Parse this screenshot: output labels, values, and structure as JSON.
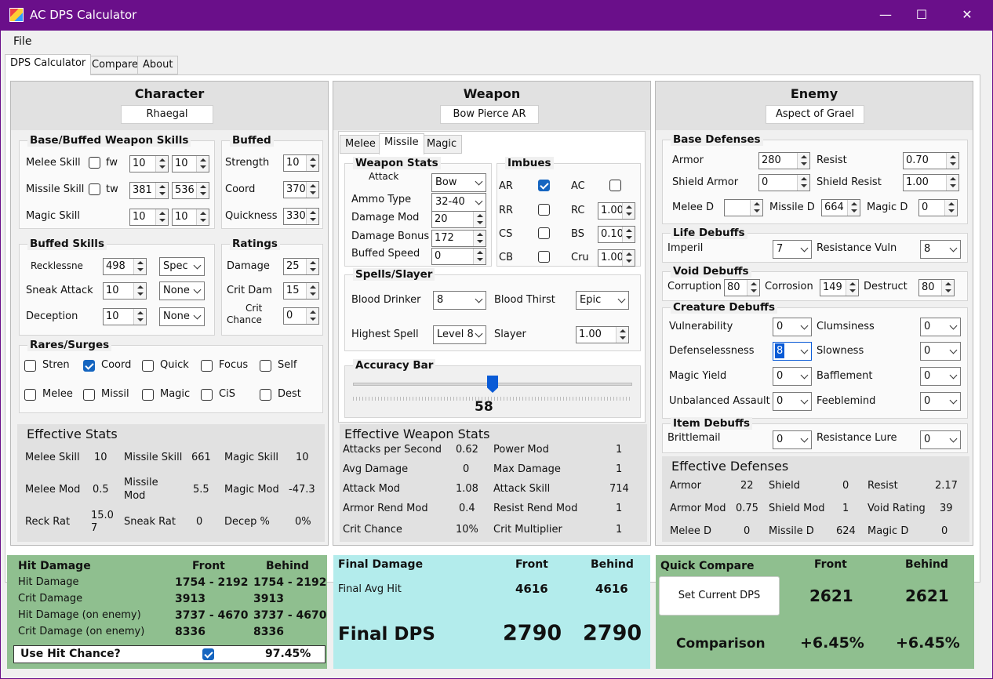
{
  "window": {
    "title": "AC DPS Calculator",
    "min": "—",
    "max": "☐",
    "close": "✕"
  },
  "menu": {
    "file": "File"
  },
  "tabs": [
    "DPS Calculator",
    "Compare",
    "About"
  ],
  "character": {
    "header": "Character",
    "name": "Rhaegal",
    "base_group": "Base/Buffed Weapon Skills",
    "melee_label": "Melee Skill",
    "fw": "fw",
    "melee_base": "10",
    "melee_buffed": "10",
    "missile_label": "Missile Skill",
    "tw": "tw",
    "missile_base": "381",
    "missile_buffed": "536",
    "magic_label": "Magic Skill",
    "magic_base": "10",
    "magic_buffed": "10",
    "buffed_group": "Buffed",
    "strength_label": "Strength",
    "strength": "10",
    "coord_label": "Coord",
    "coord": "370",
    "quick_label": "Quickness",
    "quick": "330",
    "bskills_group": "Buffed Skills",
    "reck_label": "Recklessne",
    "reck": "498",
    "reck_sel": "Spec",
    "sneak_label": "Sneak Attack",
    "sneak": "10",
    "sneak_sel": "None",
    "dec_label": "Deception",
    "dec": "10",
    "dec_sel": "None",
    "ratings_group": "Ratings",
    "dmg_label": "Damage",
    "dmg": "25",
    "critdam_label": "Crit Dam",
    "critdam": "15",
    "critch_label1": "Crit",
    "critch_label2": "Chance",
    "critch": "0",
    "rares_group": "Rares/Surges",
    "rares": [
      {
        "l": "Stren",
        "on": false
      },
      {
        "l": "Coord",
        "on": true
      },
      {
        "l": "Quick",
        "on": false
      },
      {
        "l": "Focus",
        "on": false
      },
      {
        "l": "Self",
        "on": false
      },
      {
        "l": "Melee",
        "on": false
      },
      {
        "l": "Missil",
        "on": false
      },
      {
        "l": "Magic",
        "on": false
      },
      {
        "l": "CiS",
        "on": false
      },
      {
        "l": "Dest",
        "on": false
      }
    ],
    "eff_header": "Effective Stats",
    "eff": {
      "melee_skill_l": "Melee Skill",
      "melee_skill": "10",
      "missile_skill_l": "Missile Skill",
      "missile_skill": "661",
      "magic_skill_l": "Magic Skill",
      "magic_skill": "10",
      "melee_mod_l": "Melee Mod",
      "melee_mod": "0.5",
      "missile_mod_l1": "Missile",
      "missile_mod_l2": "Mod",
      "missile_mod": "5.5",
      "magic_mod_l": "Magic Mod",
      "magic_mod": "-47.3",
      "reck_rat_l": "Reck Rat",
      "reck_rat1": "15.0",
      "reck_rat2": "7",
      "sneak_rat_l": "Sneak Rat",
      "sneak_rat": "0",
      "decep_l": "Decep %",
      "decep": "0%"
    }
  },
  "weapon": {
    "header": "Weapon",
    "name": "Bow Pierce AR",
    "subtabs": [
      "Melee",
      "Missile",
      "Magic"
    ],
    "stats_group": "Weapon Stats",
    "attack_label": "Attack",
    "attack": "Bow",
    "ammo_label": "Ammo Type",
    "ammo": "32-40",
    "dmgmod_label": "Damage Mod",
    "dmgmod": "20",
    "dmgbonus_label": "Damage Bonus",
    "dmgbonus": "172",
    "speed_label": "Buffed Speed",
    "speed": "0",
    "imbues_group": "Imbues",
    "ar": "AR",
    "ac": "AC",
    "rr": "RR",
    "rc": "RC",
    "rc_v": "1.00",
    "cs": "CS",
    "bs": "BS",
    "bs_v": "0.10",
    "cb": "CB",
    "cru": "Cru",
    "cru_v": "1.00",
    "spells_group": "Spells/Slayer",
    "bd_label": "Blood Drinker",
    "bd": "8",
    "bt_label": "Blood Thirst",
    "bt": "Epic",
    "hs_label": "Highest Spell",
    "hs": "Level 8",
    "slayer_label": "Slayer",
    "slayer": "1.00",
    "acc_group": "Accuracy Bar",
    "acc": "58",
    "acc_frac": 0.5,
    "eff_header": "Effective Weapon Stats",
    "eff": {
      "aps_l": "Attacks per Second",
      "aps": "0.62",
      "pm_l": "Power Mod",
      "pm": "1",
      "avg_l": "Avg Damage",
      "avg": "0",
      "maxd_l": "Max Damage",
      "maxd": "1",
      "am_l": "Attack Mod",
      "am": "1.08",
      "as_l": "Attack Skill",
      "as": "714",
      "arm_l": "Armor Rend Mod",
      "arm": "0.4",
      "rrm_l": "Resist Rend Mod",
      "rrm": "1",
      "cc_l": "Crit Chance",
      "cc": "10%",
      "cm_l": "Crit Multiplier",
      "cm": "1"
    }
  },
  "enemy": {
    "header": "Enemy",
    "name": "Aspect of Grael",
    "base_group": "Base Defenses",
    "armor_l": "Armor",
    "armor": "280",
    "resist_l": "Resist",
    "resist": "0.70",
    "sarmor_l": "Shield Armor",
    "sarmor": "0",
    "sresist_l": "Shield Resist",
    "sresist": "1.00",
    "meleed_l": "Melee D",
    "meleed": "",
    "missiled_l": "Missile D",
    "missiled": "664",
    "magicd_l": "Magic D",
    "magicd": "0",
    "life_group": "Life Debuffs",
    "imperil_l": "Imperil",
    "imperil": "7",
    "rvuln_l": "Resistance Vuln",
    "rvuln": "8",
    "void_group": "Void Debuffs",
    "corr_l": "Corruption",
    "corr": "80",
    "corro_l": "Corrosion",
    "corro": "149",
    "dest_l": "Destruct",
    "dest": "80",
    "creature_group": "Creature Debuffs",
    "vuln_l": "Vulnerability",
    "vuln": "0",
    "clum_l": "Clumsiness",
    "clum": "0",
    "def_l": "Defenselessness",
    "def": "8",
    "slow_l": "Slowness",
    "slow": "0",
    "my_l": "Magic Yield",
    "my": "0",
    "baf_l": "Bafflement",
    "baf": "0",
    "ua_l": "Unbalanced Assault",
    "ua": "0",
    "fee_l": "Feeblemind",
    "fee": "0",
    "item_group": "Item Debuffs",
    "brit_l": "Brittlemail",
    "brit": "0",
    "rl_l": "Resistance Lure",
    "rl": "0",
    "eff_header": "Effective Defenses",
    "eff": {
      "armor_l": "Armor",
      "armor": "22",
      "shield_l": "Shield",
      "shield": "0",
      "resist_l": "Resist",
      "resist": "2.17",
      "amod_l": "Armor Mod",
      "amod": "0.75",
      "smod_l": "Shield Mod",
      "smod": "1",
      "void_l": "Void Rating",
      "void": "39",
      "meleed_l": "Melee D",
      "meleed": "0",
      "missiled_l": "Missile D",
      "missiled": "624",
      "magicd_l": "Magic D",
      "magicd": "0"
    }
  },
  "hit": {
    "title": "Hit Damage",
    "front": "Front",
    "behind": "Behind",
    "rows": [
      {
        "l": "Hit Damage",
        "f": "1754 - 2192",
        "b": "1754 - 2192"
      },
      {
        "l": "Crit Damage",
        "f": "3913",
        "b": "3913"
      },
      {
        "l": "Hit Damage (on enemy)",
        "f": "3737 - 4670",
        "b": "3737 - 4670"
      },
      {
        "l": "Crit Damage (on enemy)",
        "f": "8336",
        "b": "8336"
      }
    ],
    "use_hit": "Use Hit Chance?",
    "hit_pct": "97.45%"
  },
  "final": {
    "title": "Final Damage",
    "front": "Front",
    "behind": "Behind",
    "avg_l": "Final Avg Hit",
    "avg_f": "4616",
    "avg_b": "4616",
    "dps_l": "Final DPS",
    "dps_f": "2790",
    "dps_b": "2790"
  },
  "quick": {
    "title": "Quick Compare",
    "front": "Front",
    "behind": "Behind",
    "btn": "Set Current DPS",
    "cur_f": "2621",
    "cur_b": "2621",
    "cmp_l": "Comparison",
    "cmp_f": "+6.45%",
    "cmp_b": "+6.45%"
  },
  "colors": {
    "title_bar": "#6a0f8a",
    "bottom_green": "#8fbf8f",
    "final_cyan": "#b3ecec",
    "check_blue": "#1565c0"
  }
}
